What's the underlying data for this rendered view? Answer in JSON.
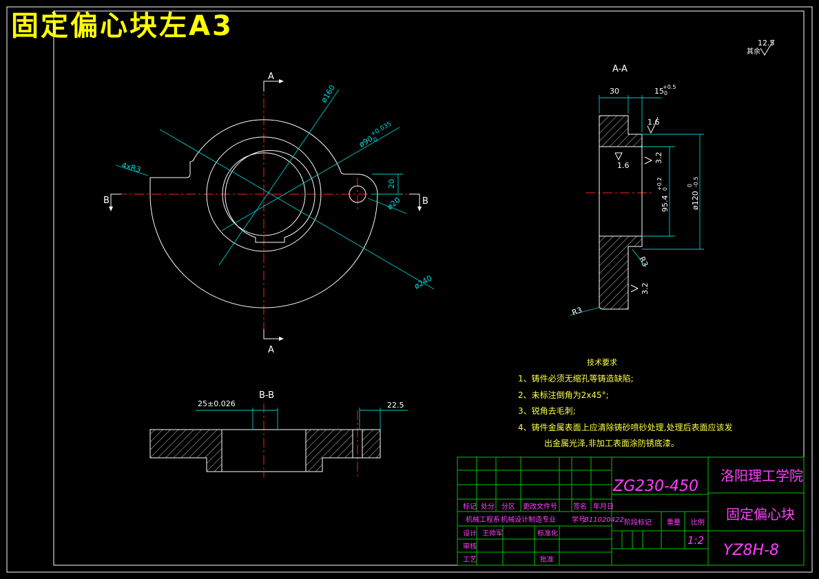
{
  "title": "固定偏心块左A3",
  "views": {
    "main": {
      "section_a_top": "A",
      "section_a_bottom": "A",
      "section_b_left": "B",
      "section_b_right": "B",
      "dim_d160": "ø160",
      "dim_d90": "ø90",
      "dim_d90_tol": "+0.035",
      "dim_d90_tol_low": "0",
      "dim_r3": "4xR3",
      "dim_20": "20",
      "dim_d20": "ø20",
      "dim_d240": "ø240"
    },
    "section_aa": {
      "label": "A-A",
      "dim_30": "30",
      "dim_15": "15",
      "dim_15_tol": "+0.5",
      "dim_15_tol_low": "0",
      "rough_16_top": "1.6",
      "rough_16_mid": "1.6",
      "rough_32_top": "3.2",
      "rough_32_bottom": "3.2",
      "dim_954": "95.4",
      "dim_954_tol": "+0.2",
      "dim_954_tol_low": "0",
      "dim_d120": "ø120",
      "dim_d120_tol": "0",
      "dim_d120_tol_low": "-0.5",
      "dim_r3_inner": "R3",
      "dim_r3_outer": "R3"
    },
    "section_bb": {
      "label": "B-B",
      "dim_25": "25±0.026",
      "dim_225": "22.5"
    }
  },
  "roughness_rest": {
    "value": "12.5",
    "label": "其余"
  },
  "tech_requirements": {
    "heading": "技术要求",
    "items": [
      "1、铸件必须无缩孔等铸造缺陷;",
      "2、未标注倒角为2x45°;",
      "3、锐角去毛刺;",
      "4、铸件金属表面上应清除铸砂喷砂处理,处理后表面应该发",
      "出金属光泽,非加工表面涂防锈底漆。"
    ]
  },
  "title_block": {
    "material": "ZG230-450",
    "school": "洛阳理工学院",
    "part_name": "固定偏心块",
    "drawing_no": "YZ8H-8",
    "scale": "1:2",
    "headers": {
      "mark": "标记",
      "count": "处分",
      "zone": "分区",
      "doc_no": "更改文件号",
      "sign": "签名",
      "date": "年月日",
      "stage": "阶段标记",
      "weight": "重量",
      "ratio": "比例",
      "designer": "设计",
      "check": "审核",
      "process": "工艺",
      "standard": "标准化",
      "approve": "批准"
    },
    "dept_line": "机械工程系",
    "major_line": "机械设计制造专业",
    "student_label": "学号",
    "student_no": "B11020422",
    "designer_name": "王帅军"
  },
  "colors": {
    "background": "#000000",
    "outline": "#ffffff",
    "center_line": "#ff2020",
    "dimension": "#00cccc",
    "title_block": "#00c800",
    "title_text": "#ffff00"
  }
}
